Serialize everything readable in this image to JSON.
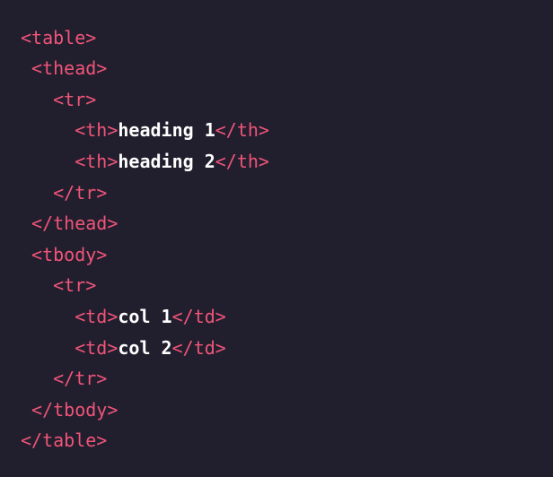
{
  "theme": {
    "background": "#211e2e",
    "tag_color": "#f05578",
    "text_color": "#ffffff"
  },
  "code": {
    "lines": [
      {
        "indent": "",
        "tokens": [
          {
            "type": "tag",
            "text": "<table>"
          }
        ]
      },
      {
        "indent": " ",
        "tokens": [
          {
            "type": "tag",
            "text": "<thead>"
          }
        ]
      },
      {
        "indent": "   ",
        "tokens": [
          {
            "type": "tag",
            "text": "<tr>"
          }
        ]
      },
      {
        "indent": "     ",
        "tokens": [
          {
            "type": "tag",
            "text": "<th>"
          },
          {
            "type": "text",
            "text": "heading 1"
          },
          {
            "type": "tag",
            "text": "</th>"
          }
        ]
      },
      {
        "indent": "     ",
        "tokens": [
          {
            "type": "tag",
            "text": "<th>"
          },
          {
            "type": "text",
            "text": "heading 2"
          },
          {
            "type": "tag",
            "text": "</th>"
          }
        ]
      },
      {
        "indent": "   ",
        "tokens": [
          {
            "type": "tag",
            "text": "</tr>"
          }
        ]
      },
      {
        "indent": " ",
        "tokens": [
          {
            "type": "tag",
            "text": "</thead>"
          }
        ]
      },
      {
        "indent": " ",
        "tokens": [
          {
            "type": "tag",
            "text": "<tbody>"
          }
        ]
      },
      {
        "indent": "   ",
        "tokens": [
          {
            "type": "tag",
            "text": "<tr>"
          }
        ]
      },
      {
        "indent": "     ",
        "tokens": [
          {
            "type": "tag",
            "text": "<td>"
          },
          {
            "type": "text",
            "text": "col 1"
          },
          {
            "type": "tag",
            "text": "</td>"
          }
        ]
      },
      {
        "indent": "     ",
        "tokens": [
          {
            "type": "tag",
            "text": "<td>"
          },
          {
            "type": "text",
            "text": "col 2"
          },
          {
            "type": "tag",
            "text": "</td>"
          }
        ]
      },
      {
        "indent": "   ",
        "tokens": [
          {
            "type": "tag",
            "text": "</tr>"
          }
        ]
      },
      {
        "indent": " ",
        "tokens": [
          {
            "type": "tag",
            "text": "</tbody>"
          }
        ]
      },
      {
        "indent": "",
        "tokens": [
          {
            "type": "tag",
            "text": "</table>"
          }
        ]
      }
    ]
  }
}
